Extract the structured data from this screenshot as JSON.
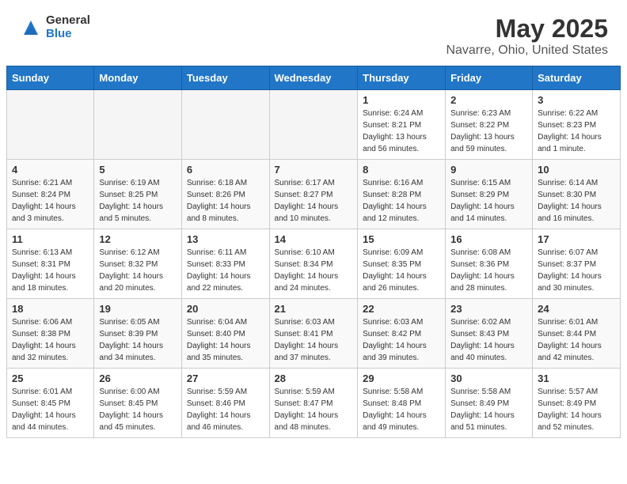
{
  "logo": {
    "general": "General",
    "blue": "Blue"
  },
  "title": "May 2025",
  "subtitle": "Navarre, Ohio, United States",
  "days_of_week": [
    "Sunday",
    "Monday",
    "Tuesday",
    "Wednesday",
    "Thursday",
    "Friday",
    "Saturday"
  ],
  "weeks": [
    [
      {
        "day": "",
        "info": ""
      },
      {
        "day": "",
        "info": ""
      },
      {
        "day": "",
        "info": ""
      },
      {
        "day": "",
        "info": ""
      },
      {
        "day": "1",
        "info": "Sunrise: 6:24 AM\nSunset: 8:21 PM\nDaylight: 13 hours and 56 minutes."
      },
      {
        "day": "2",
        "info": "Sunrise: 6:23 AM\nSunset: 8:22 PM\nDaylight: 13 hours and 59 minutes."
      },
      {
        "day": "3",
        "info": "Sunrise: 6:22 AM\nSunset: 8:23 PM\nDaylight: 14 hours and 1 minute."
      }
    ],
    [
      {
        "day": "4",
        "info": "Sunrise: 6:21 AM\nSunset: 8:24 PM\nDaylight: 14 hours and 3 minutes."
      },
      {
        "day": "5",
        "info": "Sunrise: 6:19 AM\nSunset: 8:25 PM\nDaylight: 14 hours and 5 minutes."
      },
      {
        "day": "6",
        "info": "Sunrise: 6:18 AM\nSunset: 8:26 PM\nDaylight: 14 hours and 8 minutes."
      },
      {
        "day": "7",
        "info": "Sunrise: 6:17 AM\nSunset: 8:27 PM\nDaylight: 14 hours and 10 minutes."
      },
      {
        "day": "8",
        "info": "Sunrise: 6:16 AM\nSunset: 8:28 PM\nDaylight: 14 hours and 12 minutes."
      },
      {
        "day": "9",
        "info": "Sunrise: 6:15 AM\nSunset: 8:29 PM\nDaylight: 14 hours and 14 minutes."
      },
      {
        "day": "10",
        "info": "Sunrise: 6:14 AM\nSunset: 8:30 PM\nDaylight: 14 hours and 16 minutes."
      }
    ],
    [
      {
        "day": "11",
        "info": "Sunrise: 6:13 AM\nSunset: 8:31 PM\nDaylight: 14 hours and 18 minutes."
      },
      {
        "day": "12",
        "info": "Sunrise: 6:12 AM\nSunset: 8:32 PM\nDaylight: 14 hours and 20 minutes."
      },
      {
        "day": "13",
        "info": "Sunrise: 6:11 AM\nSunset: 8:33 PM\nDaylight: 14 hours and 22 minutes."
      },
      {
        "day": "14",
        "info": "Sunrise: 6:10 AM\nSunset: 8:34 PM\nDaylight: 14 hours and 24 minutes."
      },
      {
        "day": "15",
        "info": "Sunrise: 6:09 AM\nSunset: 8:35 PM\nDaylight: 14 hours and 26 minutes."
      },
      {
        "day": "16",
        "info": "Sunrise: 6:08 AM\nSunset: 8:36 PM\nDaylight: 14 hours and 28 minutes."
      },
      {
        "day": "17",
        "info": "Sunrise: 6:07 AM\nSunset: 8:37 PM\nDaylight: 14 hours and 30 minutes."
      }
    ],
    [
      {
        "day": "18",
        "info": "Sunrise: 6:06 AM\nSunset: 8:38 PM\nDaylight: 14 hours and 32 minutes."
      },
      {
        "day": "19",
        "info": "Sunrise: 6:05 AM\nSunset: 8:39 PM\nDaylight: 14 hours and 34 minutes."
      },
      {
        "day": "20",
        "info": "Sunrise: 6:04 AM\nSunset: 8:40 PM\nDaylight: 14 hours and 35 minutes."
      },
      {
        "day": "21",
        "info": "Sunrise: 6:03 AM\nSunset: 8:41 PM\nDaylight: 14 hours and 37 minutes."
      },
      {
        "day": "22",
        "info": "Sunrise: 6:03 AM\nSunset: 8:42 PM\nDaylight: 14 hours and 39 minutes."
      },
      {
        "day": "23",
        "info": "Sunrise: 6:02 AM\nSunset: 8:43 PM\nDaylight: 14 hours and 40 minutes."
      },
      {
        "day": "24",
        "info": "Sunrise: 6:01 AM\nSunset: 8:44 PM\nDaylight: 14 hours and 42 minutes."
      }
    ],
    [
      {
        "day": "25",
        "info": "Sunrise: 6:01 AM\nSunset: 8:45 PM\nDaylight: 14 hours and 44 minutes."
      },
      {
        "day": "26",
        "info": "Sunrise: 6:00 AM\nSunset: 8:45 PM\nDaylight: 14 hours and 45 minutes."
      },
      {
        "day": "27",
        "info": "Sunrise: 5:59 AM\nSunset: 8:46 PM\nDaylight: 14 hours and 46 minutes."
      },
      {
        "day": "28",
        "info": "Sunrise: 5:59 AM\nSunset: 8:47 PM\nDaylight: 14 hours and 48 minutes."
      },
      {
        "day": "29",
        "info": "Sunrise: 5:58 AM\nSunset: 8:48 PM\nDaylight: 14 hours and 49 minutes."
      },
      {
        "day": "30",
        "info": "Sunrise: 5:58 AM\nSunset: 8:49 PM\nDaylight: 14 hours and 51 minutes."
      },
      {
        "day": "31",
        "info": "Sunrise: 5:57 AM\nSunset: 8:49 PM\nDaylight: 14 hours and 52 minutes."
      }
    ]
  ]
}
